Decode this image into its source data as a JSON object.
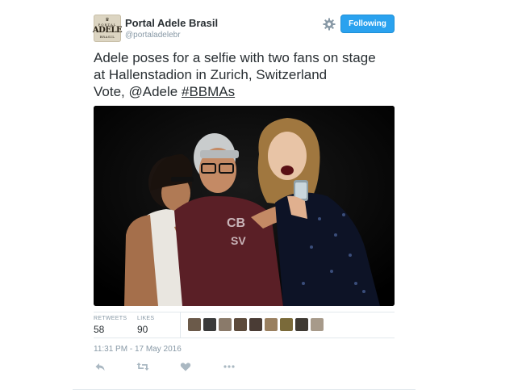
{
  "user": {
    "display_name": "Portal Adele Brasil",
    "handle": "@portaladelebr",
    "avatar_text": {
      "line1": "PORTAL",
      "line2": "ADELE",
      "line3": "BRASIL"
    }
  },
  "follow_button": {
    "label": "Following",
    "color": "#2aa2ef"
  },
  "tweet": {
    "line1": "Adele poses for a selfie with two fans on stage",
    "line2": "at Hallenstadion in Zurich, Switzerland",
    "vote_prefix": "Vote, ",
    "mention": "@Adele",
    "hashtag_symbol": "#",
    "hashtag": "BBMAs"
  },
  "stats": {
    "retweets_label": "RETWEETS",
    "retweets_value": "58",
    "likes_label": "LIKES",
    "likes_value": "90"
  },
  "likers": [
    {
      "icon": "liker-avatar",
      "color": "#6b5a4a"
    },
    {
      "icon": "liker-avatar",
      "color": "#3a3a3a"
    },
    {
      "icon": "liker-avatar",
      "color": "#8a7a6a"
    },
    {
      "icon": "liker-avatar",
      "color": "#5c4a3b"
    },
    {
      "icon": "liker-avatar",
      "color": "#4a3c35"
    },
    {
      "icon": "liker-avatar",
      "color": "#9a8060"
    },
    {
      "icon": "liker-avatar",
      "color": "#7a6a3a"
    },
    {
      "icon": "liker-avatar",
      "color": "#3f3a33"
    },
    {
      "icon": "liker-avatar",
      "color": "#a79a8a"
    }
  ],
  "timestamp": "11:31 PM - 17 May 2016",
  "actions": [
    "reply-icon",
    "retweet-icon",
    "like-icon",
    "more-icon"
  ],
  "colors": {
    "muted": "#8899a6",
    "text": "#292f33",
    "accent": "#2aa2ef",
    "border": "#e1e8ed"
  }
}
